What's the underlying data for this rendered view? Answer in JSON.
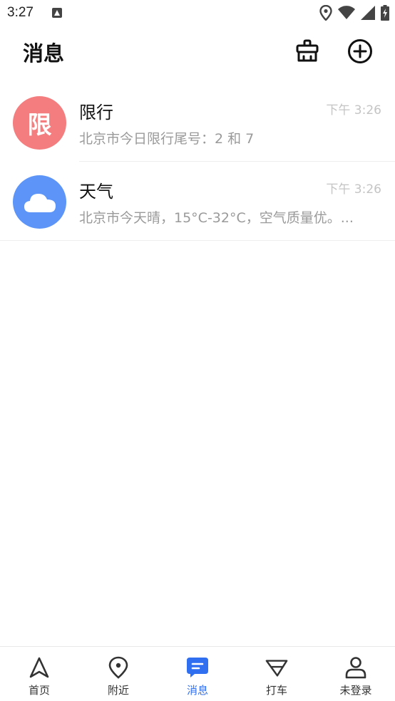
{
  "status_bar": {
    "time": "3:27"
  },
  "header": {
    "title": "消息"
  },
  "messages": [
    {
      "avatar_text": "限",
      "title": "限行",
      "time": "下午 3:26",
      "preview": "北京市今日限行尾号：2 和 7"
    },
    {
      "avatar_icon": "cloud-icon",
      "title": "天气",
      "time": "下午 3:26",
      "preview": "北京市今天晴，15°C-32°C，空气质量优。..."
    }
  ],
  "tabbar": {
    "tabs": [
      {
        "label": "首页",
        "icon": "navigation-arrow-icon"
      },
      {
        "label": "附近",
        "icon": "location-pin-icon"
      },
      {
        "label": "消息",
        "icon": "message-icon",
        "active": true
      },
      {
        "label": "打车",
        "icon": "taxi-icon"
      },
      {
        "label": "未登录",
        "icon": "user-icon"
      }
    ]
  },
  "colors": {
    "accent": "#2f6ff0",
    "limit_avatar": "#f47e7f",
    "weather_avatar": "#5c95f7"
  }
}
